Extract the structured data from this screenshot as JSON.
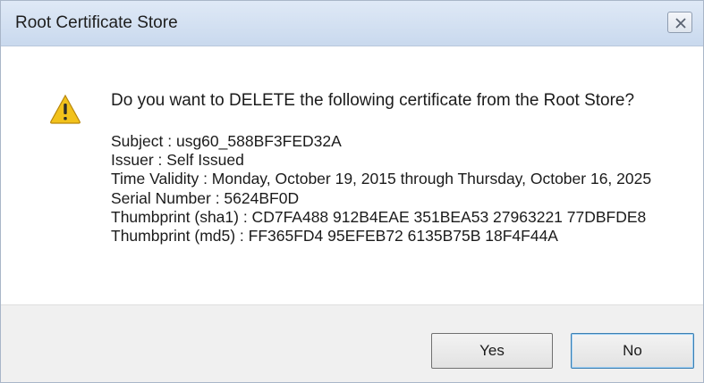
{
  "window": {
    "title": "Root Certificate Store",
    "close_icon": "close-icon"
  },
  "message": {
    "icon": "warning-icon",
    "question": "Do you want to DELETE the following certificate from the Root Store?",
    "subject": "Subject : usg60_588BF3FED32A",
    "issuer": "Issuer : Self Issued",
    "validity": "Time Validity : Monday, October 19, 2015 through Thursday, October 16, 2025",
    "serial": "Serial Number : 5624BF0D",
    "thumbprint_sha1": "Thumbprint (sha1) : CD7FA488 912B4EAE 351BEA53 27963221 77DBFDE8",
    "thumbprint_md5": "Thumbprint (md5) : FF365FD4 95EFEB72 6135B75B 18F4F44A"
  },
  "buttons": {
    "yes": "Yes",
    "no": "No"
  },
  "colors": {
    "titlebar": "#c9d9ee",
    "footer": "#f0f0f0",
    "warning": "#f2c21b",
    "focus_border": "#3c7fb1"
  }
}
